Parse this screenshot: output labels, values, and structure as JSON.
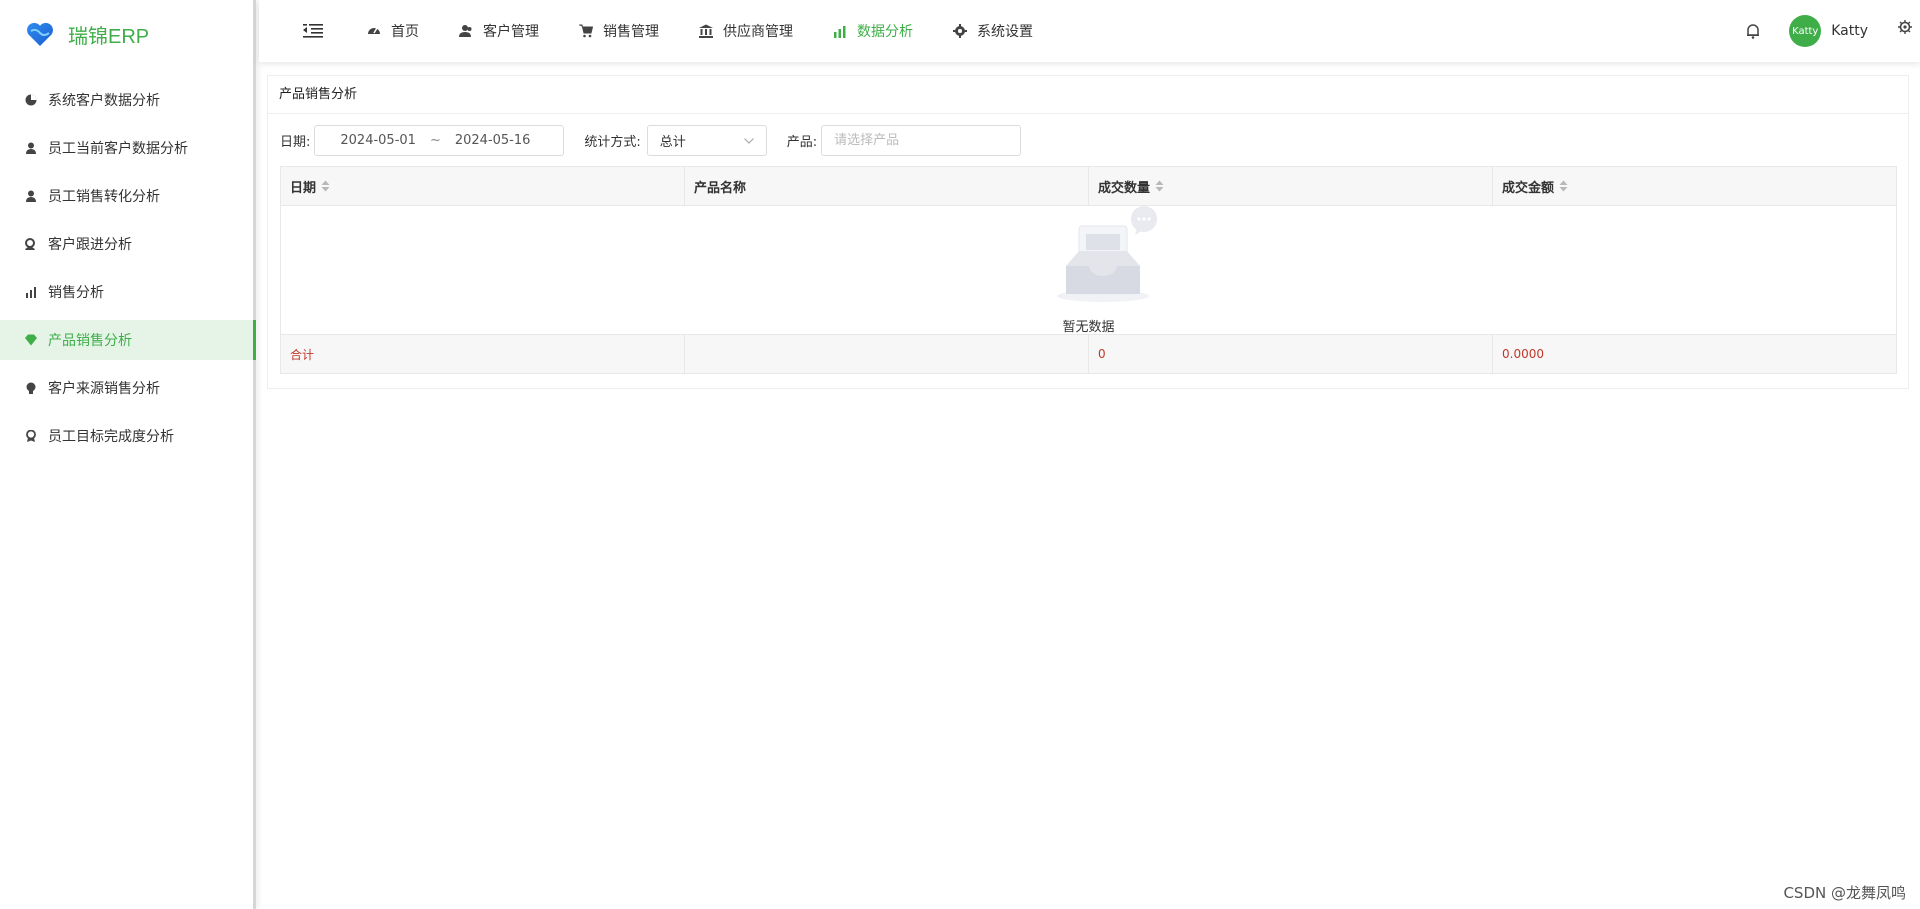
{
  "app": {
    "title": "瑞锦ERP"
  },
  "sidebar": {
    "items": [
      {
        "label": "系统客户数据分析",
        "icon": "pie-icon",
        "active": false
      },
      {
        "label": "员工当前客户数据分析",
        "icon": "user-icon",
        "active": false
      },
      {
        "label": "员工销售转化分析",
        "icon": "user-icon",
        "active": false
      },
      {
        "label": "客户跟进分析",
        "icon": "user-search-icon",
        "active": false
      },
      {
        "label": "销售分析",
        "icon": "bar-chart-icon",
        "active": false
      },
      {
        "label": "产品销售分析",
        "icon": "diamond-icon",
        "active": true
      },
      {
        "label": "客户来源销售分析",
        "icon": "bulb-icon",
        "active": false
      },
      {
        "label": "员工目标完成度分析",
        "icon": "award-icon",
        "active": false
      }
    ]
  },
  "header": {
    "nav": [
      {
        "label": "首页",
        "icon": "dashboard-icon",
        "active": false
      },
      {
        "label": "客户管理",
        "icon": "users-icon",
        "active": false
      },
      {
        "label": "销售管理",
        "icon": "cart-icon",
        "active": false
      },
      {
        "label": "供应商管理",
        "icon": "bank-icon",
        "active": false
      },
      {
        "label": "数据分析",
        "icon": "bar-chart-icon",
        "active": true
      },
      {
        "label": "系统设置",
        "icon": "gear-icon",
        "active": false
      }
    ],
    "user": {
      "avatar_text": "Katty",
      "name": "Katty"
    }
  },
  "main": {
    "title": "产品销售分析",
    "filters": {
      "date_label": "日期:",
      "date_start": "2024-05-01",
      "date_sep": "~",
      "date_end": "2024-05-16",
      "method_label": "统计方式:",
      "method_value": "总计",
      "product_label": "产品:",
      "product_placeholder": "请选择产品"
    },
    "table": {
      "columns": [
        "日期",
        "产品名称",
        "成交数量",
        "成交金额"
      ],
      "empty_text": "暂无数据",
      "footer": [
        "合计",
        "",
        "0",
        "0.0000"
      ]
    }
  },
  "watermark": "CSDN @龙舞凤鸣",
  "colors": {
    "accent": "#3fae49",
    "sum_text": "#c0392b"
  }
}
